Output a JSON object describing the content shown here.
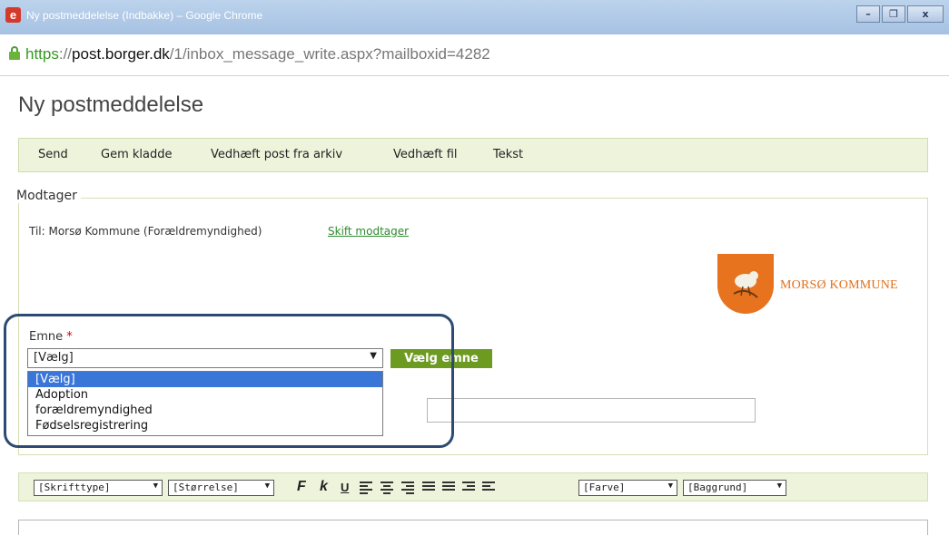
{
  "window": {
    "title": "Ny postmeddelelse (Indbakke) – Google Chrome",
    "app_icon_letter": "e"
  },
  "address": {
    "scheme": "https",
    "sep": "://",
    "host": "post.borger.dk",
    "path": "/1/inbox_message_write.aspx?mailboxid=4282"
  },
  "page": {
    "title": "Ny postmeddelelse"
  },
  "toolbar": {
    "send": "Send",
    "save_draft": "Gem kladde",
    "attach_archive": "Vedhæft post fra arkiv",
    "attach_file": "Vedhæft fil",
    "text": "Tekst"
  },
  "recipient": {
    "legend": "Modtager",
    "to": "Til: Morsø Kommune (Forældremyndighed)",
    "change_link": "Skift modtager",
    "logo_text": "MORSØ KOMMUNE"
  },
  "subject": {
    "label": "Emne",
    "required_mark": "*",
    "selected": "[Vælg]",
    "button": "Vælg emne",
    "options": [
      "[Vælg]",
      "Adoption",
      "forældremyndighed",
      "Fødselsregistrering"
    ]
  },
  "editor": {
    "font_select": "[Skrifttype]",
    "size_select": "[Størrelse]",
    "bold": "F",
    "italic": "k",
    "underline": "U",
    "color_select": "[Farve]",
    "background_select": "[Baggrund]"
  },
  "colors": {
    "accent_green": "#6d9b22",
    "toolbar_bg": "#eef4dc",
    "highlight": "#2c4a73",
    "logo_orange": "#e8731e"
  }
}
